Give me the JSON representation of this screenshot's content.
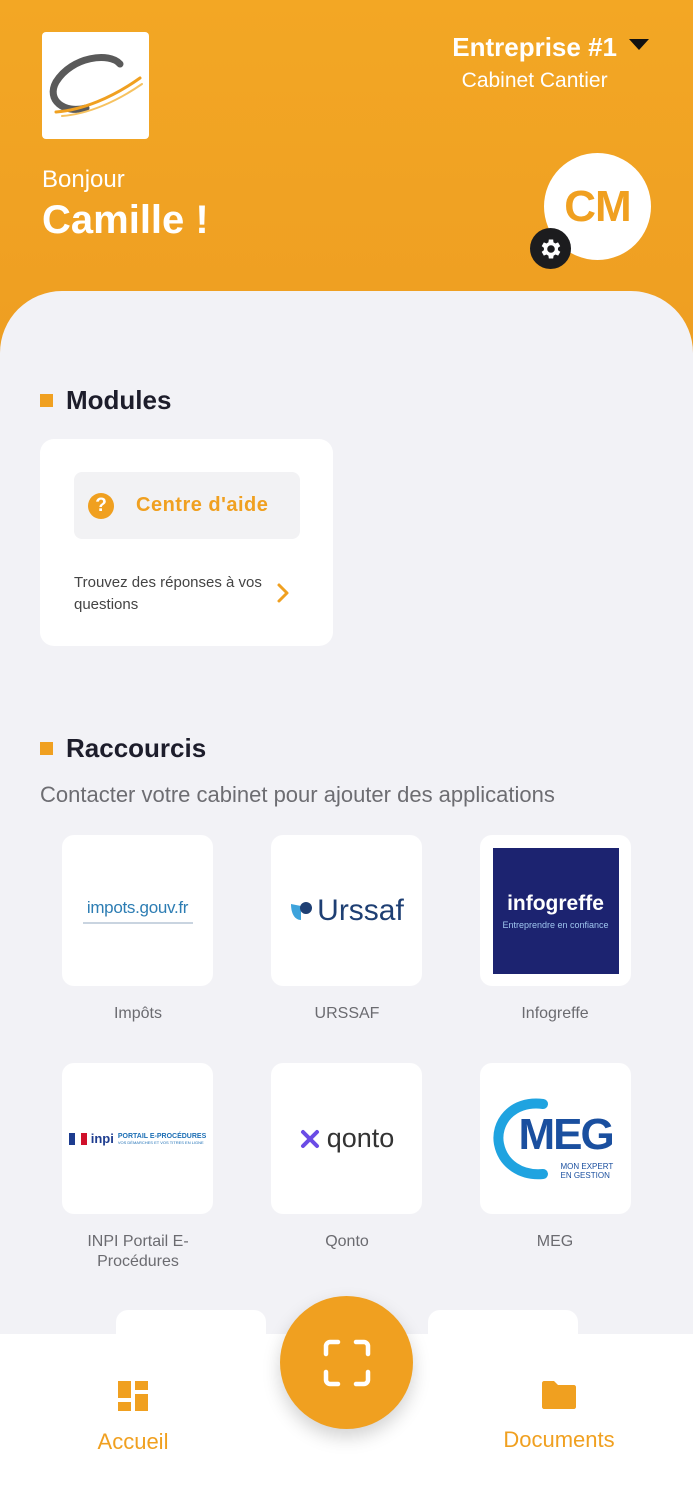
{
  "header": {
    "company_name": "Entreprise #1",
    "company_subtitle": "Cabinet Cantier",
    "greeting": "Bonjour",
    "user_name": "Camille !",
    "avatar_initials": "CM"
  },
  "modules": {
    "title": "Modules",
    "help_center": {
      "label": "Centre d'aide",
      "icon_glyph": "?",
      "description": "Trouvez des réponses à vos questions"
    }
  },
  "shortcuts": {
    "title": "Raccourcis",
    "subtitle": "Contacter votre cabinet pour ajouter des applications",
    "items": [
      {
        "label": "Impôts",
        "logo_text": "impots.gouv.fr",
        "logo_domain": "gouv.fr"
      },
      {
        "label": "URSSAF",
        "logo_text": "Urssaf"
      },
      {
        "label": "Infogreffe",
        "logo_text": "infogreffe",
        "logo_tagline": "Entreprendre en confiance"
      },
      {
        "label": "INPI Portail E-Procédures",
        "logo_text": "PORTAIL E-PROCÉDURES",
        "logo_tagline": "VOS DÉMARCHES ET VOS TITRES EN LIGNE"
      },
      {
        "label": "Qonto",
        "logo_text": "qonto"
      },
      {
        "label": "MEG",
        "logo_text": "MEG",
        "logo_tagline": "MON EXPERT EN GESTION"
      }
    ]
  },
  "nav": {
    "home_label": "Accueil",
    "documents_label": "Documents"
  },
  "colors": {
    "accent": "#f0a020",
    "header_bg": "#f3a724",
    "background": "#f2f2f6",
    "infogreffe_bg": "#1c2370",
    "urssaf_blue": "#1e3f73",
    "meg_blue": "#1a4f9f",
    "qonto_purple": "#6b4ce6"
  },
  "icons": {
    "logo": "cabinet-cantier-logo",
    "dropdown": "caret-down-icon",
    "settings": "gear-icon",
    "help": "question-circle-icon",
    "chevron": "chevron-right-icon",
    "home": "dashboard-grid-icon",
    "scan": "scan-frame-icon",
    "documents": "folder-icon"
  }
}
